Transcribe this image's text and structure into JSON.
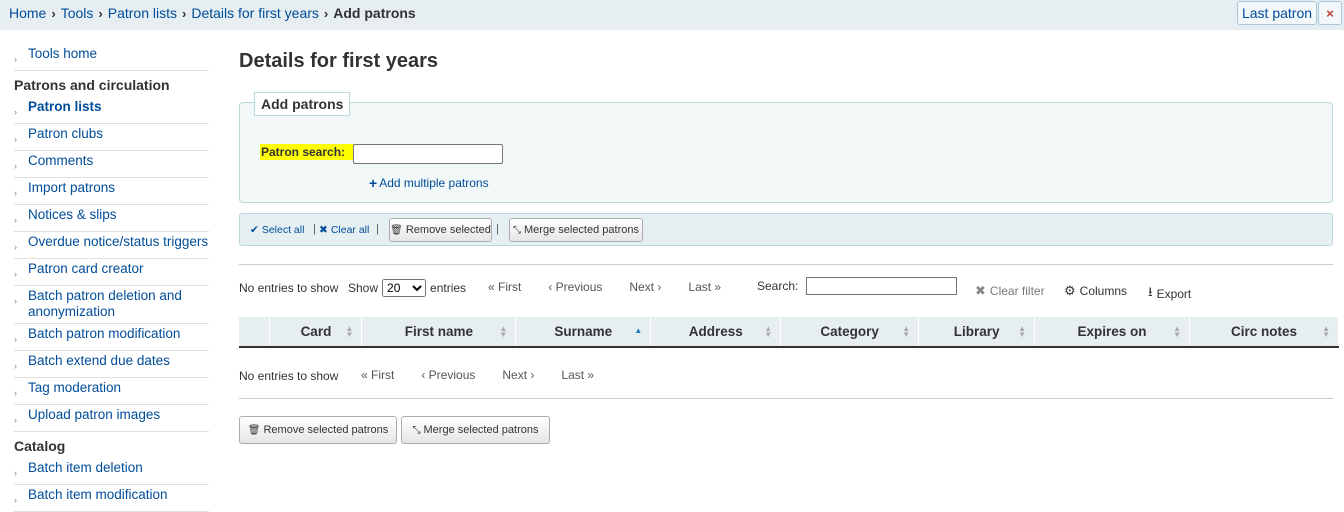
{
  "breadcrumb": {
    "items": [
      "Home",
      "Tools",
      "Patron lists",
      "Details for first years"
    ],
    "current": "Add patrons",
    "separator": "›"
  },
  "last_patron": {
    "label": "Last patron",
    "close": "×"
  },
  "sidebar": {
    "top_link": "Tools home",
    "sections": [
      {
        "heading": "Patrons and circulation",
        "items": [
          "Patron lists",
          "Patron clubs",
          "Comments",
          "Import patrons",
          "Notices & slips",
          "Overdue notice/status triggers",
          "Patron card creator",
          "Batch patron deletion and anonymization",
          "Batch patron modification",
          "Batch extend due dates",
          "Tag moderation",
          "Upload patron images"
        ]
      },
      {
        "heading": "Catalog",
        "items": [
          "Batch item deletion",
          "Batch item modification"
        ]
      }
    ],
    "active": "Patron lists"
  },
  "main": {
    "title": "Details for first years",
    "add_patrons": {
      "legend": "Add patrons",
      "search_label": "Patron search:",
      "search_value": "",
      "add_multiple": "Add multiple patrons"
    },
    "toolbar": {
      "select_all": "Select all",
      "clear_all": "Clear all",
      "remove_selected": "Remove selected",
      "merge_selected": "Merge selected patrons"
    },
    "datatable": {
      "info": "No entries to show",
      "show_label": "Show",
      "page_length": "20",
      "entries_label": "entries",
      "pager": {
        "first": "« First",
        "previous": "‹ Previous",
        "next": "Next ›",
        "last": "Last »"
      },
      "search_label": "Search:",
      "search_value": "",
      "clear_filter": "Clear filter",
      "columns": "Columns",
      "export": "Export",
      "headers": [
        "",
        "Card",
        "First name",
        "Surname",
        "Address",
        "Category",
        "Library",
        "Expires on",
        "Circ notes"
      ],
      "sorted_column": "Surname"
    },
    "bottom_buttons": {
      "remove": "Remove selected patrons",
      "merge": "Merge selected patrons"
    }
  },
  "colors": {
    "link": "#004d99",
    "highlight": "#ffff00",
    "topbar": "#e6eef2"
  }
}
